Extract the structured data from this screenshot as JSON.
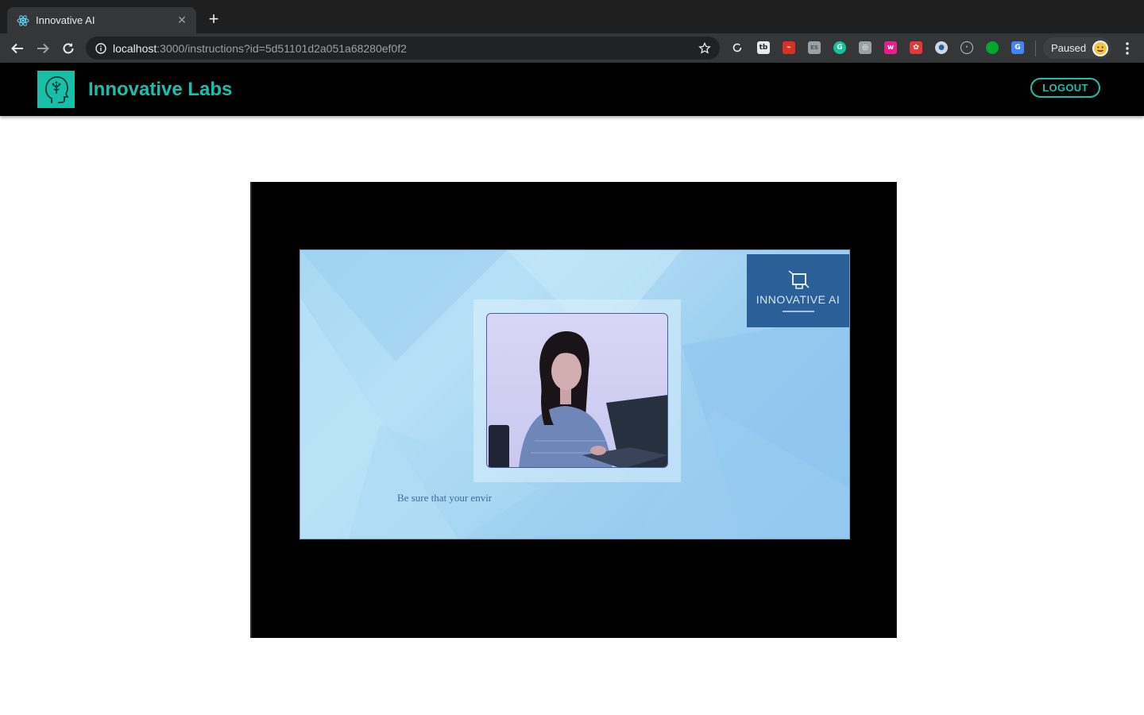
{
  "browser": {
    "tab": {
      "title": "Innovative AI",
      "favicon": "react-logo-icon"
    },
    "address": {
      "host": "localhost",
      "rest": ":3000/instructions?id=5d51101d2a051a68280ef0f2"
    },
    "extensions": [
      "reload-icon",
      "tb-extension-icon",
      "red-extension-icon",
      "es-extension-icon",
      "grammarly-icon",
      "camera-extension-icon",
      "w-extension-icon",
      "red-gift-extension-icon",
      "blue-circle-extension-icon",
      "circle-extension-icon",
      "evernote-icon",
      "translate-extension-icon"
    ],
    "profile": {
      "label": "Paused"
    }
  },
  "app": {
    "brand": "Innovative Labs",
    "logout_label": "LOGOUT",
    "colors": {
      "accent": "#1bbfa9",
      "header_bg": "#000000"
    }
  },
  "video": {
    "watermark": "INNOVATIVE AI",
    "caption": "Be sure that your envir"
  }
}
